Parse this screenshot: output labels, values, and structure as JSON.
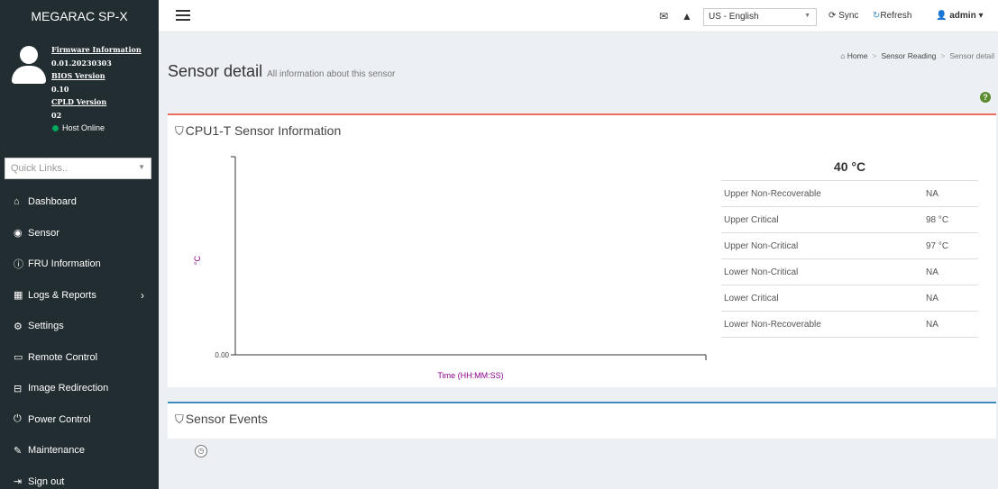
{
  "sidebar": {
    "brand": "MEGARAC SP-X",
    "firmware_label": "Firmware Information",
    "firmware_value": "0.01.20230303",
    "bios_label": "BIOS Version",
    "bios_value": "0.10",
    "cpld_label": "CPLD Version",
    "cpld_value": "02",
    "host_status": "Host Online",
    "quick_links_placeholder": "Quick Links..",
    "items": [
      {
        "label": "Dashboard",
        "icon": "home-icon"
      },
      {
        "label": "Sensor",
        "icon": "tachometer-icon"
      },
      {
        "label": "FRU Information",
        "icon": "info-icon"
      },
      {
        "label": "Logs & Reports",
        "icon": "bar-chart-icon"
      },
      {
        "label": "Settings",
        "icon": "gear-icon"
      },
      {
        "label": "Remote Control",
        "icon": "monitor-icon"
      },
      {
        "label": "Image Redirection",
        "icon": "drive-icon"
      },
      {
        "label": "Power Control",
        "icon": "power-icon"
      },
      {
        "label": "Maintenance",
        "icon": "wrench-icon"
      },
      {
        "label": "Sign out",
        "icon": "sign-out-icon"
      }
    ]
  },
  "navbar": {
    "language": "US - English",
    "sync_label": "Sync",
    "refresh_label": "Refresh",
    "user_label": "admin"
  },
  "page": {
    "title": "Sensor detail",
    "subtitle": "All information about this sensor",
    "breadcrumb": [
      "Home",
      "Sensor Reading",
      "Sensor detail"
    ]
  },
  "sensor_box": {
    "title": "CPU1-T Sensor Information",
    "current_reading": "40 °C",
    "thresholds": [
      {
        "name": "Upper Non-Recoverable",
        "value": "NA"
      },
      {
        "name": "Upper Critical",
        "value": "98 °C"
      },
      {
        "name": "Upper Non-Critical",
        "value": "97 °C"
      },
      {
        "name": "Lower Non-Critical",
        "value": "NA"
      },
      {
        "name": "Lower Critical",
        "value": "NA"
      },
      {
        "name": "Lower Non-Recoverable",
        "value": "NA"
      }
    ]
  },
  "chart_data": {
    "type": "line",
    "title": "",
    "xlabel": "Time (HH:MM:SS)",
    "ylabel": "°C",
    "y_tick_labels": [
      "0.00"
    ],
    "series": []
  },
  "events_box": {
    "title": "Sensor Events"
  },
  "colors": {
    "sidebar_bg": "#222d32",
    "sensor_box_border": "#e96e5c",
    "events_box_border": "#3c8dbc",
    "axis_label": "#8b008b",
    "host_online": "#00a65a"
  }
}
